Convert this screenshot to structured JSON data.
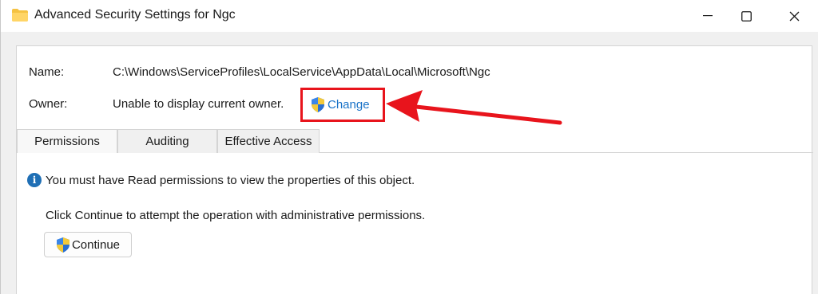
{
  "window": {
    "title": "Advanced Security Settings for Ngc",
    "minimize_glyph": "—",
    "maximize_glyph": "☐",
    "close_glyph": "✕"
  },
  "fields": {
    "name_label": "Name:",
    "name_value": "C:\\Windows\\ServiceProfiles\\LocalService\\AppData\\Local\\Microsoft\\Ngc",
    "owner_label": "Owner:",
    "owner_value": "Unable to display current owner.",
    "change_link": "Change"
  },
  "tabs": [
    {
      "label": "Permissions",
      "active": true
    },
    {
      "label": "Auditing",
      "active": false
    },
    {
      "label": "Effective Access",
      "active": false
    }
  ],
  "content": {
    "info_message": "You must have Read permissions to view the properties of this object.",
    "click_message": "Click Continue to attempt the operation with administrative permissions.",
    "continue_button": "Continue"
  },
  "icons": {
    "title": "folder-icon",
    "change": "shield-icon",
    "info": "info-icon",
    "continue": "shield-icon"
  },
  "colors": {
    "highlight": "#e8141c",
    "link": "#1a73c8",
    "info": "#1f6fb5"
  }
}
